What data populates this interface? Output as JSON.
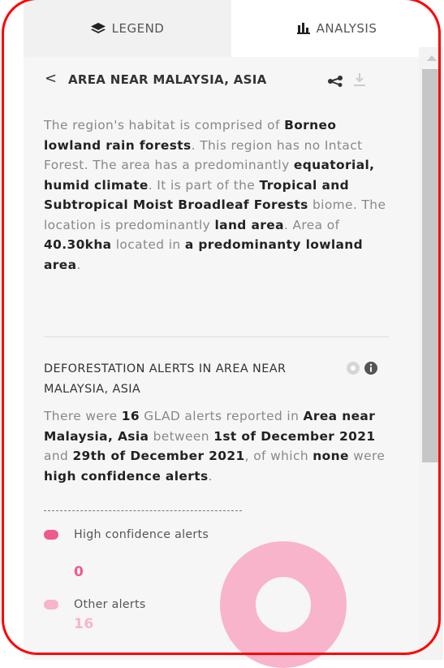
{
  "tabs": {
    "legend": "LEGEND",
    "analysis": "ANALYSIS"
  },
  "header": {
    "back_glyph": "<",
    "title": "AREA NEAR MALAYSIA, ASIA",
    "share_icon": "share-icon",
    "download_icon": "download-icon"
  },
  "description": {
    "t1": "The region's habitat is comprised of ",
    "b1": "Borneo lowland rain forests",
    "t2": ". This region has no Intact Forest. The area has a predominantly ",
    "b2": "equatorial, humid climate",
    "t3": ". It is part of the ",
    "b3": "Tropical and Subtropical Moist Broadleaf Forests",
    "t4": " biome. The location is predominantly ",
    "b4": "land area",
    "t5": ". Area of ",
    "b5": "40.30kha",
    "t6": " located in ",
    "b6": "a predominanty lowland area",
    "t7": "."
  },
  "deforestation": {
    "title": "DEFORESTATION ALERTS IN AREA NEAR MALAYSIA, ASIA",
    "t1": "There were ",
    "b1": "16",
    "t2": " GLAD alerts reported in ",
    "b2": "Area near Malaysia, Asia",
    "t3": " between ",
    "b3": "1st of December 2021",
    "t4": " and ",
    "b4": "29th of December 2021",
    "t5": ", of which ",
    "b5": "none",
    "t6": " were ",
    "b6": "high confidence alerts",
    "t7": "."
  },
  "legend": {
    "high_label": "High confidence alerts",
    "high_value": "0",
    "other_label": "Other alerts",
    "other_value": "16"
  },
  "colors": {
    "high": "#ee5a8a",
    "other": "#f8b4cb",
    "frame": "#ff0000"
  },
  "chart_data": {
    "type": "pie",
    "categories": [
      "High confidence alerts",
      "Other alerts"
    ],
    "values": [
      0,
      16
    ]
  }
}
